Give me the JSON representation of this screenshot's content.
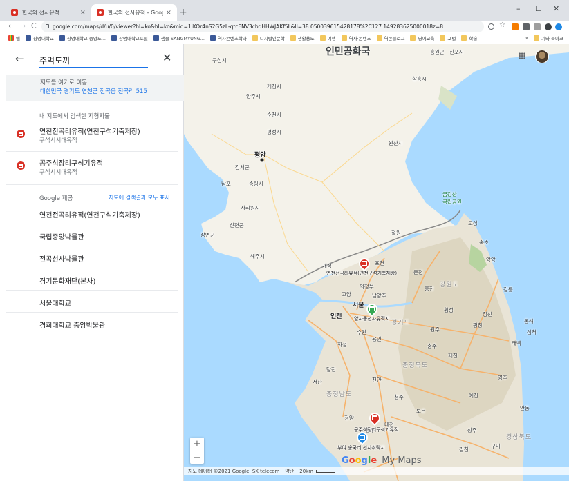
{
  "browser": {
    "tabs": [
      {
        "title": "한국의 선사유적",
        "close": "×"
      },
      {
        "title": "한국의 선사유적 - Google 내 지도",
        "close": "×"
      }
    ],
    "new_tab": "+",
    "window_controls": {
      "minimize": "–",
      "maximize": "☐",
      "close": "✕"
    },
    "nav": {
      "back": "←",
      "forward": "→",
      "reload": "C"
    },
    "url": "google.com/maps/d/u/0/viewer?hl=ko&hl=ko&mid=1iKOr4nS2G5zL-qtcENV3cbdHHWJAKf5L&ll=38.050039615428178%2C127.149283625000018z=8",
    "bookmarks": [
      {
        "label": "앱",
        "icon": "grid"
      },
      {
        "label": "상명대학교",
        "icon": "app"
      },
      {
        "label": "상명대학교 중앙도...",
        "icon": "app"
      },
      {
        "label": "상명대학교포털",
        "icon": "app"
      },
      {
        "label": "샘물 SANGMYUNG...",
        "icon": "app"
      },
      {
        "label": "역사콘텐츠학과",
        "icon": "app"
      },
      {
        "label": "디지털인문학",
        "icon": "folder"
      },
      {
        "label": "생활용도",
        "icon": "folder"
      },
      {
        "label": "여행",
        "icon": "folder"
      },
      {
        "label": "역사·콘텐츠",
        "icon": "folder"
      },
      {
        "label": "역콘블로그",
        "icon": "folder"
      },
      {
        "label": "영어교육",
        "icon": "folder"
      },
      {
        "label": "포털",
        "icon": "folder"
      },
      {
        "label": "학술",
        "icon": "folder"
      }
    ],
    "bookmarks_more": "»",
    "other_bookmarks": "기타 북마크"
  },
  "panel": {
    "back_icon": "←",
    "search_value": "주먹도끼",
    "clear_icon": "✕",
    "goto": {
      "label": "지도를 여기로 이동:",
      "address": "대한민국 경기도 연천군 전곡읍 전곡리 515"
    },
    "my_map_label": "내 지도에서 검색한 지형지물",
    "my_map_results": [
      {
        "title": "연천전곡리유적(연천구석기축제장)",
        "sub": "구석시시대유적"
      },
      {
        "title": "공주석장리구석기유적",
        "sub": "구석시시대유적"
      }
    ],
    "google_label": "Google 제공",
    "show_all": "지도에 검색결과 모두 표시",
    "google_results": [
      "연천전곡리유적(연천구석기축제장)",
      "국립중앙박물관",
      "전곡선사박물관",
      "경기문화재단(본사)",
      "서울대학교",
      "경희대학교 중앙박물관"
    ]
  },
  "map": {
    "title": "인민공화국",
    "places": [
      {
        "name": "구성시",
        "cls": ""
      },
      {
        "name": "개천시",
        "cls": ""
      },
      {
        "name": "안주시",
        "cls": ""
      },
      {
        "name": "순천시",
        "cls": ""
      },
      {
        "name": "평성시",
        "cls": ""
      },
      {
        "name": "평양",
        "cls": "big"
      },
      {
        "name": "강서군",
        "cls": ""
      },
      {
        "name": "남포",
        "cls": ""
      },
      {
        "name": "송림시",
        "cls": ""
      },
      {
        "name": "사리원시",
        "cls": ""
      },
      {
        "name": "신천군",
        "cls": ""
      },
      {
        "name": "장연군",
        "cls": ""
      },
      {
        "name": "해주시",
        "cls": ""
      },
      {
        "name": "개성",
        "cls": ""
      },
      {
        "name": "흥원군",
        "cls": ""
      },
      {
        "name": "신포시",
        "cls": ""
      },
      {
        "name": "함흥시",
        "cls": ""
      },
      {
        "name": "원산시",
        "cls": ""
      },
      {
        "name": "금강산\n국립공원",
        "cls": "park"
      },
      {
        "name": "고성",
        "cls": ""
      },
      {
        "name": "속초",
        "cls": ""
      },
      {
        "name": "양양",
        "cls": ""
      },
      {
        "name": "철원",
        "cls": ""
      },
      {
        "name": "포천",
        "cls": ""
      },
      {
        "name": "춘천",
        "cls": ""
      },
      {
        "name": "강원도",
        "cls": "prov"
      },
      {
        "name": "강릉",
        "cls": ""
      },
      {
        "name": "의정부",
        "cls": ""
      },
      {
        "name": "고양",
        "cls": ""
      },
      {
        "name": "남양주",
        "cls": ""
      },
      {
        "name": "서울",
        "cls": "big"
      },
      {
        "name": "인천",
        "cls": "big"
      },
      {
        "name": "경기도",
        "cls": "prov"
      },
      {
        "name": "홍천",
        "cls": ""
      },
      {
        "name": "횡성",
        "cls": ""
      },
      {
        "name": "원주",
        "cls": ""
      },
      {
        "name": "평창",
        "cls": ""
      },
      {
        "name": "정선",
        "cls": ""
      },
      {
        "name": "동해",
        "cls": ""
      },
      {
        "name": "삼척",
        "cls": ""
      },
      {
        "name": "태백",
        "cls": ""
      },
      {
        "name": "화성",
        "cls": ""
      },
      {
        "name": "수원",
        "cls": ""
      },
      {
        "name": "용인",
        "cls": ""
      },
      {
        "name": "충주",
        "cls": ""
      },
      {
        "name": "제천",
        "cls": ""
      },
      {
        "name": "충청북도",
        "cls": "prov"
      },
      {
        "name": "당진",
        "cls": ""
      },
      {
        "name": "천안",
        "cls": ""
      },
      {
        "name": "서산",
        "cls": ""
      },
      {
        "name": "충청남도",
        "cls": "prov"
      },
      {
        "name": "청주",
        "cls": ""
      },
      {
        "name": "보은",
        "cls": ""
      },
      {
        "name": "상주",
        "cls": ""
      },
      {
        "name": "예천",
        "cls": ""
      },
      {
        "name": "영주",
        "cls": ""
      },
      {
        "name": "안동",
        "cls": ""
      },
      {
        "name": "청양",
        "cls": ""
      },
      {
        "name": "대전",
        "cls": ""
      },
      {
        "name": "공주",
        "cls": ""
      },
      {
        "name": "구미",
        "cls": ""
      },
      {
        "name": "김천",
        "cls": ""
      },
      {
        "name": "경상북도",
        "cls": "prov"
      }
    ],
    "markers": [
      {
        "label": "연천전곡리유적(연천구석기축제장)",
        "color": "#d93025"
      },
      {
        "label": "공주석장리구석기유적",
        "color": "#d93025"
      },
      {
        "label": "암사동선사유적지",
        "color": "#34a853"
      },
      {
        "label": "부여 송국리 선사취락지",
        "color": "#1e88e5"
      }
    ],
    "zoom_in": "+",
    "zoom_out": "−",
    "logo": {
      "google": [
        "G",
        "o",
        "o",
        "g",
        "l",
        "e"
      ],
      "my_maps": "My Maps"
    },
    "attribution": "지도 데이터 ©2021 Google, SK telecom",
    "terms": "약관",
    "scale": "20km"
  },
  "colors": {
    "accent": "#1a73e8",
    "pin": "#d93025",
    "water": "#aadaff",
    "land": "#f5f3ed",
    "road": "#f6b26b"
  }
}
